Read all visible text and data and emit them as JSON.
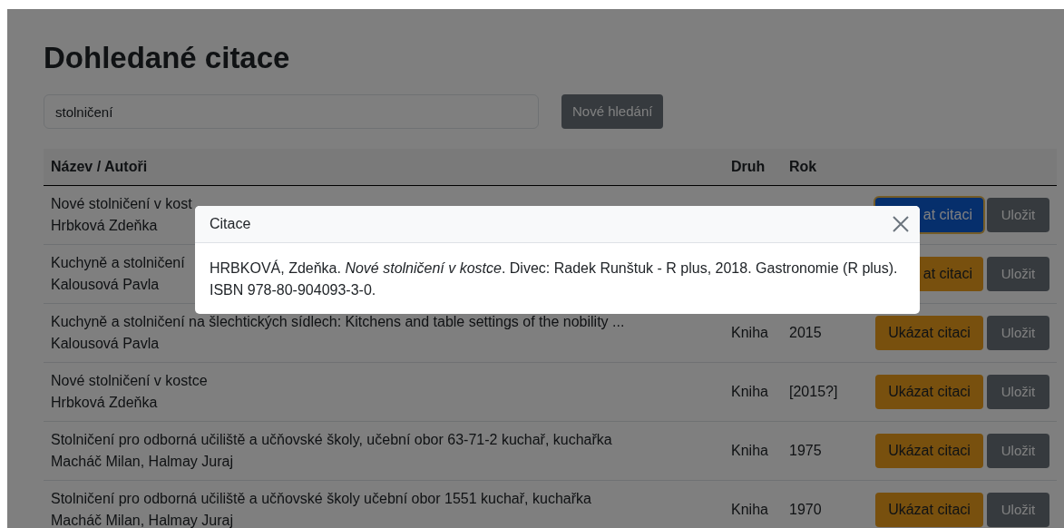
{
  "page": {
    "title": "Dohledané citace"
  },
  "search": {
    "value": "stolničení",
    "button": "Nové hledání"
  },
  "table": {
    "columns": [
      "Název / Autoři",
      "Druh",
      "Rok"
    ],
    "rows": [
      {
        "title": "Nové stolničení v kost",
        "authors": "Hrbková Zdeňka",
        "show_button": "at citaci",
        "save_button": "Uložit",
        "focused": true
      },
      {
        "title": "Kuchyně a stolničení",
        "authors": "Kalousová Pavla",
        "show_button": "at citaci",
        "save_button": "Uložit",
        "focused": false
      },
      {
        "title": "Kuchyně a stolničení na šlechtických sídlech: Kitchens and table settings of the nobility ...",
        "authors": "Kalousová Pavla",
        "type": "Kniha",
        "year": "2015",
        "show_button": "Ukázat citaci",
        "save_button": "Uložit",
        "focused": false
      },
      {
        "title": "Nové stolničení v kostce",
        "authors": "Hrbková Zdeňka",
        "type": "Kniha",
        "year": "[2015?]",
        "show_button": "Ukázat citaci",
        "save_button": "Uložit",
        "focused": false
      },
      {
        "title": "Stolničení pro odborná učiliště a učňovské školy, učební obor 63-71-2 kuchař, kuchařka",
        "authors": "Macháč Milan, Halmay Juraj",
        "type": "Kniha",
        "year": "1975",
        "show_button": "Ukázat citaci",
        "save_button": "Uložit",
        "focused": false
      },
      {
        "title": "Stolničení pro odborná učiliště a učňovské školy učební obor 1551 kuchař, kuchařka",
        "authors": "Macháč Milan, Halmay Juraj",
        "type": "Kniha",
        "year": "1970",
        "show_button": "Ukázat citaci",
        "save_button": "Uložit",
        "focused": false
      }
    ]
  },
  "modal": {
    "title": "Citace",
    "text": "HRBKOVÁ, Zdeňka. *Nové stolničení v kostce*. Divec: Radek Runštuk - R plus, 2018. Gastronomie (R plus). ISBN 978-80-904093-3-0."
  }
}
